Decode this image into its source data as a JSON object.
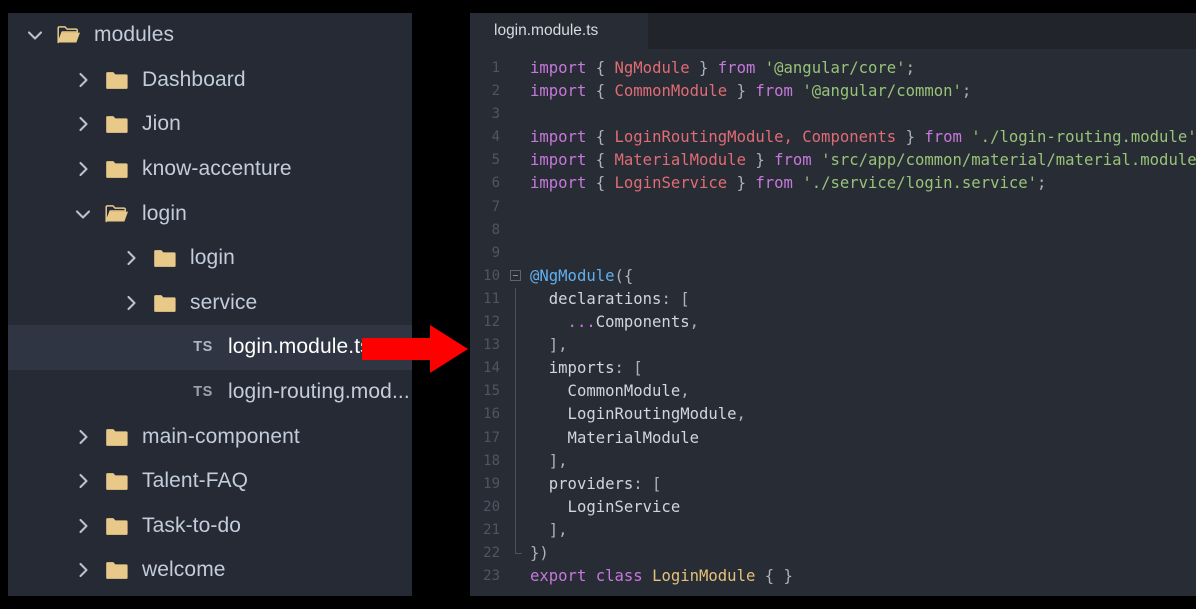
{
  "explorer": {
    "name": "file-explorer",
    "items": [
      {
        "label": "modules",
        "type": "folder",
        "state": "expanded",
        "level": 0,
        "selected": false
      },
      {
        "label": "Dashboard",
        "type": "folder",
        "state": "collapsed",
        "level": 1,
        "selected": false
      },
      {
        "label": "Jion",
        "type": "folder",
        "state": "collapsed",
        "level": 1,
        "selected": false
      },
      {
        "label": "know-accenture",
        "type": "folder",
        "state": "collapsed",
        "level": 1,
        "selected": false
      },
      {
        "label": "login",
        "type": "folder",
        "state": "expanded",
        "level": 1,
        "selected": false
      },
      {
        "label": "login",
        "type": "folder",
        "state": "collapsed",
        "level": 2,
        "selected": false
      },
      {
        "label": "service",
        "type": "folder",
        "state": "collapsed",
        "level": 2,
        "selected": false
      },
      {
        "label": "login.module.ts",
        "type": "file",
        "state": "none",
        "level": 2,
        "selected": true,
        "badge": "TS"
      },
      {
        "label": "login-routing.mod...",
        "type": "file",
        "state": "none",
        "level": 2,
        "selected": false,
        "badge": "TS"
      },
      {
        "label": "main-component",
        "type": "folder",
        "state": "collapsed",
        "level": 1,
        "selected": false
      },
      {
        "label": "Talent-FAQ",
        "type": "folder",
        "state": "collapsed",
        "level": 1,
        "selected": false
      },
      {
        "label": "Task-to-do",
        "type": "folder",
        "state": "collapsed",
        "level": 1,
        "selected": false
      },
      {
        "label": "welcome",
        "type": "folder",
        "state": "collapsed",
        "level": 1,
        "selected": false
      }
    ]
  },
  "editor": {
    "tabs": [
      {
        "label": "login.module.ts",
        "active": true
      }
    ],
    "lines": [
      {
        "n": "1",
        "fold": "none",
        "tokens": [
          {
            "t": "import",
            "c": "kw"
          },
          {
            "t": " ",
            "c": "pun"
          },
          {
            "t": "{",
            "c": "pun"
          },
          {
            "t": " ",
            "c": "pun"
          },
          {
            "t": "NgModule",
            "c": "typ"
          },
          {
            "t": " ",
            "c": "pun"
          },
          {
            "t": "}",
            "c": "pun"
          },
          {
            "t": " ",
            "c": "pun"
          },
          {
            "t": "from",
            "c": "kw"
          },
          {
            "t": " ",
            "c": "pun"
          },
          {
            "t": "'@angular/core'",
            "c": "str"
          },
          {
            "t": ";",
            "c": "pun"
          }
        ]
      },
      {
        "n": "2",
        "fold": "none",
        "tokens": [
          {
            "t": "import",
            "c": "kw"
          },
          {
            "t": " ",
            "c": "pun"
          },
          {
            "t": "{",
            "c": "pun"
          },
          {
            "t": " ",
            "c": "pun"
          },
          {
            "t": "CommonModule",
            "c": "typ"
          },
          {
            "t": " ",
            "c": "pun"
          },
          {
            "t": "}",
            "c": "pun"
          },
          {
            "t": " ",
            "c": "pun"
          },
          {
            "t": "from",
            "c": "kw"
          },
          {
            "t": " ",
            "c": "pun"
          },
          {
            "t": "'@angular/common'",
            "c": "str"
          },
          {
            "t": ";",
            "c": "pun"
          }
        ]
      },
      {
        "n": "3",
        "fold": "none",
        "tokens": []
      },
      {
        "n": "4",
        "fold": "none",
        "tokens": [
          {
            "t": "import",
            "c": "kw"
          },
          {
            "t": " ",
            "c": "pun"
          },
          {
            "t": "{",
            "c": "pun"
          },
          {
            "t": " ",
            "c": "pun"
          },
          {
            "t": "LoginRoutingModule, Components",
            "c": "typ"
          },
          {
            "t": " ",
            "c": "pun"
          },
          {
            "t": "}",
            "c": "pun"
          },
          {
            "t": " ",
            "c": "pun"
          },
          {
            "t": "from",
            "c": "kw"
          },
          {
            "t": " ",
            "c": "pun"
          },
          {
            "t": "'./login-routing.module'",
            "c": "str"
          },
          {
            "t": ";",
            "c": "pun"
          }
        ]
      },
      {
        "n": "5",
        "fold": "none",
        "tokens": [
          {
            "t": "import",
            "c": "kw"
          },
          {
            "t": " ",
            "c": "pun"
          },
          {
            "t": "{",
            "c": "pun"
          },
          {
            "t": " ",
            "c": "pun"
          },
          {
            "t": "MaterialModule",
            "c": "typ"
          },
          {
            "t": " ",
            "c": "pun"
          },
          {
            "t": "}",
            "c": "pun"
          },
          {
            "t": " ",
            "c": "pun"
          },
          {
            "t": "from",
            "c": "kw"
          },
          {
            "t": " ",
            "c": "pun"
          },
          {
            "t": "'src/app/common/material/material.module'",
            "c": "str"
          },
          {
            "t": ";",
            "c": "pun"
          }
        ]
      },
      {
        "n": "6",
        "fold": "none",
        "tokens": [
          {
            "t": "import",
            "c": "kw"
          },
          {
            "t": " ",
            "c": "pun"
          },
          {
            "t": "{",
            "c": "pun"
          },
          {
            "t": " ",
            "c": "pun"
          },
          {
            "t": "LoginService",
            "c": "typ"
          },
          {
            "t": " ",
            "c": "pun"
          },
          {
            "t": "}",
            "c": "pun"
          },
          {
            "t": " ",
            "c": "pun"
          },
          {
            "t": "from",
            "c": "kw"
          },
          {
            "t": " ",
            "c": "pun"
          },
          {
            "t": "'./service/login.service'",
            "c": "str"
          },
          {
            "t": ";",
            "c": "pun"
          }
        ]
      },
      {
        "n": "7",
        "fold": "none",
        "tokens": []
      },
      {
        "n": "8",
        "fold": "none",
        "tokens": []
      },
      {
        "n": "9",
        "fold": "none",
        "tokens": []
      },
      {
        "n": "10",
        "fold": "box",
        "tokens": [
          {
            "t": "@NgModule",
            "c": "dec"
          },
          {
            "t": "({",
            "c": "pun"
          }
        ]
      },
      {
        "n": "11",
        "fold": "line",
        "tokens": [
          {
            "t": "  declarations",
            "c": "prop"
          },
          {
            "t": ": [",
            "c": "pun"
          }
        ]
      },
      {
        "n": "12",
        "fold": "line",
        "tokens": [
          {
            "t": "    ...",
            "c": "kw"
          },
          {
            "t": "Components",
            "c": "prop"
          },
          {
            "t": ",",
            "c": "pun"
          }
        ]
      },
      {
        "n": "13",
        "fold": "line",
        "tokens": [
          {
            "t": "  ],",
            "c": "pun"
          }
        ]
      },
      {
        "n": "14",
        "fold": "line",
        "tokens": [
          {
            "t": "  imports",
            "c": "prop"
          },
          {
            "t": ": [",
            "c": "pun"
          }
        ]
      },
      {
        "n": "15",
        "fold": "line",
        "tokens": [
          {
            "t": "    CommonModule",
            "c": "prop"
          },
          {
            "t": ",",
            "c": "pun"
          }
        ]
      },
      {
        "n": "16",
        "fold": "line",
        "tokens": [
          {
            "t": "    LoginRoutingModule",
            "c": "prop"
          },
          {
            "t": ",",
            "c": "pun"
          }
        ]
      },
      {
        "n": "17",
        "fold": "line",
        "tokens": [
          {
            "t": "    MaterialModule",
            "c": "prop"
          }
        ]
      },
      {
        "n": "18",
        "fold": "line",
        "tokens": [
          {
            "t": "  ],",
            "c": "pun"
          }
        ]
      },
      {
        "n": "19",
        "fold": "line",
        "tokens": [
          {
            "t": "  providers",
            "c": "prop"
          },
          {
            "t": ": [",
            "c": "pun"
          }
        ]
      },
      {
        "n": "20",
        "fold": "line",
        "tokens": [
          {
            "t": "    LoginService",
            "c": "prop"
          }
        ]
      },
      {
        "n": "21",
        "fold": "line",
        "tokens": [
          {
            "t": "  ],",
            "c": "pun"
          }
        ]
      },
      {
        "n": "22",
        "fold": "end",
        "tokens": [
          {
            "t": "})",
            "c": "pun"
          }
        ]
      },
      {
        "n": "23",
        "fold": "none",
        "tokens": [
          {
            "t": "export",
            "c": "kw"
          },
          {
            "t": " ",
            "c": "pun"
          },
          {
            "t": "class",
            "c": "kw"
          },
          {
            "t": " ",
            "c": "pun"
          },
          {
            "t": "LoginModule",
            "c": "cls"
          },
          {
            "t": " ",
            "c": "pun"
          },
          {
            "t": "{ }",
            "c": "pun"
          }
        ]
      }
    ]
  },
  "annotation": {
    "arrow_label": "red-arrow-pointing-to-editor",
    "arrow_color": "#fe0000"
  },
  "colors": {
    "page_background": "#000000",
    "sidebar_background": "#252a35",
    "sidebar_selected": "#2f3542",
    "editor_background": "#282c34",
    "tabbar_background": "#21252b",
    "folder_icon": "#e8c98a",
    "keyword": "#c678dd",
    "type": "#e06c75",
    "string": "#98c379",
    "decorator": "#61afef",
    "class_name": "#e5c07b",
    "punctuation": "#abb2bf",
    "line_number": "#4e5666"
  }
}
